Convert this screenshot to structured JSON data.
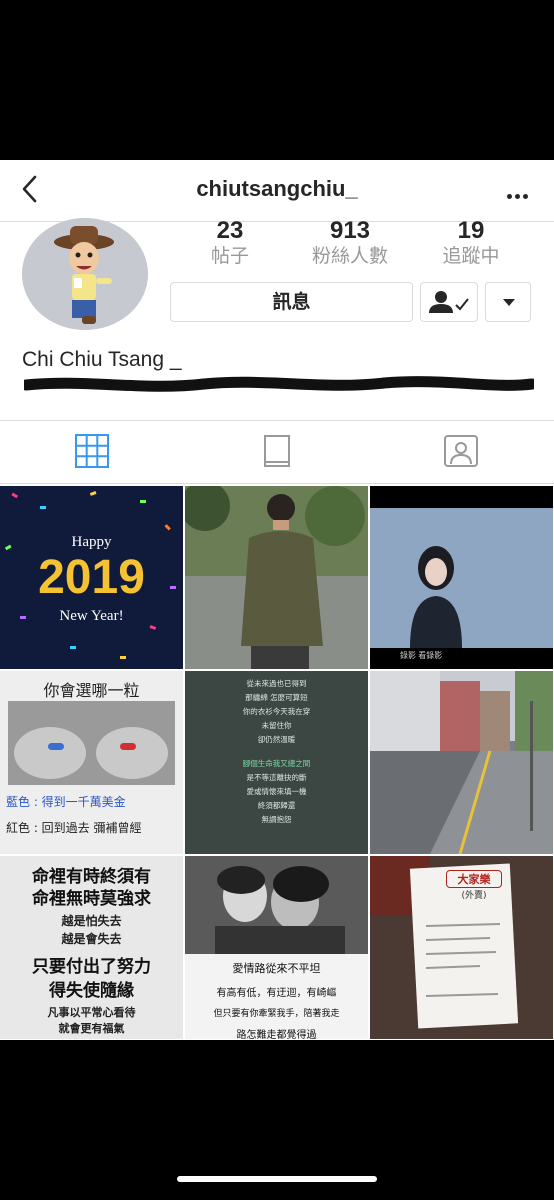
{
  "header": {
    "username": "chiutsangchiu_",
    "back_icon": "chevron-left-icon",
    "more_icon": "more-horizontal-icon"
  },
  "profile": {
    "stats": [
      {
        "value": "23",
        "label": "帖子"
      },
      {
        "value": "913",
        "label": "粉絲人數"
      },
      {
        "value": "19",
        "label": "追蹤中"
      }
    ],
    "message_button": "訊息",
    "display_name": "Chi Chiu Tsang _"
  },
  "tabs": [
    {
      "icon": "grid-icon",
      "active": true
    },
    {
      "icon": "feed-icon",
      "active": false
    },
    {
      "icon": "tagged-icon",
      "active": false
    }
  ],
  "posts": {
    "p1": {
      "line1": "Happy",
      "line2": "2019",
      "line3": "New Year!"
    },
    "p3": {
      "caption": "錄影 看錄影"
    },
    "p4": {
      "title": "你會選哪一粒",
      "blue": "藍色 : 得到一千萬美金",
      "red": "紅色 : 回到過去 彌補曾經"
    },
    "p5": {
      "l1": "從未來過也已得到",
      "l2": "那纏綿 怎麼可算短",
      "l3": "你的衣衫今天我在穿",
      "l4": "未留住你",
      "l5": "卻仍然溫暖",
      "l6": "腳個生命我又總之間",
      "l7": "是不等這離抉的斷",
      "l8": "愛或情懷來填一機",
      "l9": "終須都歸還",
      "l10": "無謂抱怨"
    },
    "p7": {
      "l1": "命裡有時終須有",
      "l2": "命裡無時莫強求",
      "l3": "越是怕失去",
      "l4": "越是會失去",
      "l5": "只要付出了努力",
      "l6": "得失使隨緣",
      "l7": "凡事以平常心看待",
      "l8": "就會更有福氣"
    },
    "p8": {
      "l1": "愛情路從來不平坦",
      "l2": "有高有低，有迂迴，有崎嶇",
      "l3": "但只要有你牽緊我手，陪著我走",
      "l4": "路怎難走都覺得過"
    },
    "p9": {
      "l1": "大家樂",
      "l2": "(外賣)"
    }
  }
}
